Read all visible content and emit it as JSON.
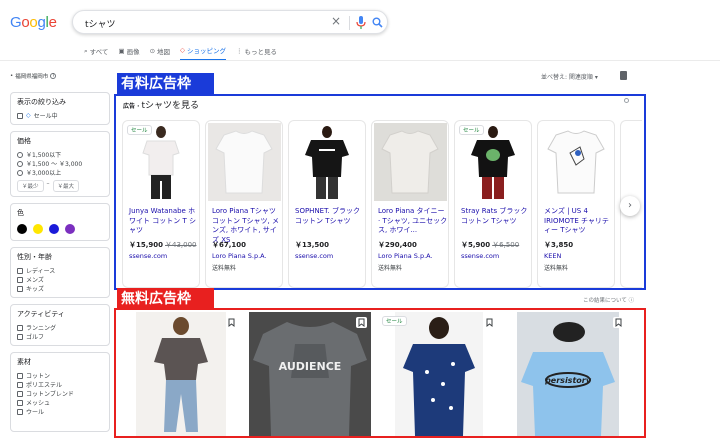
{
  "header": {
    "logo": "Google",
    "query": "tシャツ"
  },
  "tabs": [
    {
      "label": "すべて",
      "icon": "search-icon",
      "active": false
    },
    {
      "label": "画像",
      "icon": "image-icon",
      "active": false
    },
    {
      "label": "地図",
      "icon": "map-pin-icon",
      "active": false
    },
    {
      "label": "ショッピング",
      "icon": "tag-icon",
      "active": true
    },
    {
      "label": "もっと見る",
      "icon": "more-vert-icon",
      "active": false
    }
  ],
  "location": "福岡県福岡市",
  "sort": {
    "label": "並べ替え: 関連度順"
  },
  "filters": {
    "narrow": {
      "title": "表示の絞り込み",
      "option": "セール中"
    },
    "price": {
      "title": "価格",
      "options": [
        "￥1,500以下",
        "￥1,500 ～ ￥3,000",
        "￥3,000以上"
      ],
      "min": "￥最少",
      "max": "￥最大"
    },
    "color": {
      "title": "色",
      "swatches": [
        "#000000",
        "#ffe600",
        "#1a1ad9",
        "#7b2fbf"
      ]
    },
    "gender": {
      "title": "性別・年齢",
      "options": [
        "レディース",
        "メンズ",
        "キッズ"
      ]
    },
    "activity": {
      "title": "アクティビティ",
      "options": [
        "ランニング",
        "ゴルフ"
      ]
    },
    "material": {
      "title": "素材",
      "options": [
        "コットン",
        "ポリエステル",
        "コットンブレンド",
        "メッシュ",
        "ウール"
      ]
    }
  },
  "annotations": {
    "paid": "有料広告枠",
    "free": "無料広告枠"
  },
  "ads": {
    "heading_prefix": "広告 · ",
    "heading": "tシャツを見る",
    "about": "この結果について",
    "sale_badge": "セール",
    "cards": [
      {
        "title": "Junya Watanabe ホワイト コットン T シャツ",
        "price": "￥15,900",
        "old": "￥43,000",
        "store": "ssense.com",
        "ship": "",
        "sale": true
      },
      {
        "title": "Loro Piana Tシャツ コットン Tシャツ, メンズ, ホワイト, サイズ XS",
        "price": "￥67,100",
        "old": "",
        "store": "Loro Piana S.p.A.",
        "ship": "送料無料",
        "sale": false
      },
      {
        "title": "SOPHNET. ブラック コットン Tシャツ",
        "price": "￥13,500",
        "old": "",
        "store": "ssense.com",
        "ship": "",
        "sale": false
      },
      {
        "title": "Loro Piana タイニー · Tシャツ, ユニセックス, ホワイ...",
        "price": "￥290,400",
        "old": "",
        "store": "Loro Piana S.p.A.",
        "ship": "送料無料",
        "sale": false
      },
      {
        "title": "Stray Rats ブラック コットン Tシャツ",
        "price": "￥5,900",
        "old": "￥6,500",
        "store": "ssense.com",
        "ship": "",
        "sale": true
      },
      {
        "title": "メンズ | US 4 IRIOMOTE チャリティー Tシャツ",
        "price": "￥3,850",
        "old": "",
        "store": "KEEN",
        "ship": "送料無料",
        "sale": false
      }
    ]
  },
  "free": {
    "sale_badge": "セール",
    "shirt_text": "AUDIENCE",
    "shirt_text2": "persistory"
  }
}
